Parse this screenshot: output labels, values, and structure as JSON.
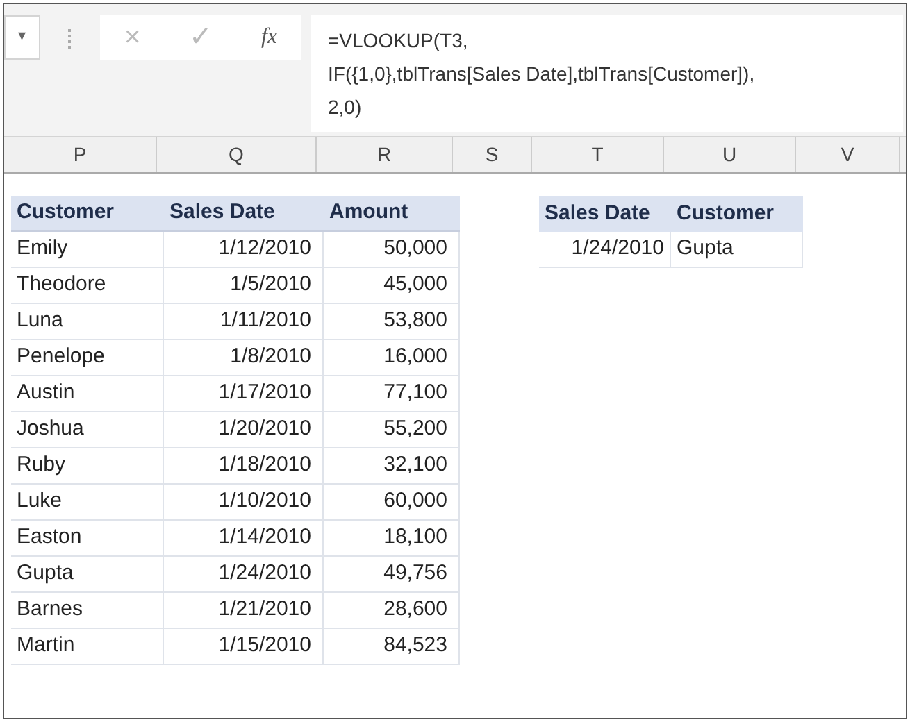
{
  "formula_bar": {
    "name_box_caret": "▾",
    "cancel": "×",
    "enter": "✓",
    "fx": "fx",
    "formula_lines": [
      "=VLOOKUP(T3,",
      "IF({1,0},tblTrans[Sales Date],tblTrans[Customer]),",
      "2,0)"
    ]
  },
  "column_headers": [
    "P",
    "Q",
    "R",
    "S",
    "T",
    "U",
    "V"
  ],
  "sales_table": {
    "columns": [
      "Customer",
      "Sales Date",
      "Amount"
    ],
    "rows": [
      [
        "Emily",
        "1/12/2010",
        "50,000"
      ],
      [
        "Theodore",
        "1/5/2010",
        "45,000"
      ],
      [
        "Luna",
        "1/11/2010",
        "53,800"
      ],
      [
        "Penelope",
        "1/8/2010",
        "16,000"
      ],
      [
        "Austin",
        "1/17/2010",
        "77,100"
      ],
      [
        "Joshua",
        "1/20/2010",
        "55,200"
      ],
      [
        "Ruby",
        "1/18/2010",
        "32,100"
      ],
      [
        "Luke",
        "1/10/2010",
        "60,000"
      ],
      [
        "Easton",
        "1/14/2010",
        "18,100"
      ],
      [
        "Gupta",
        "1/24/2010",
        "49,756"
      ],
      [
        "Barnes",
        "1/21/2010",
        "28,600"
      ],
      [
        "Martin",
        "1/15/2010",
        "84,523"
      ]
    ]
  },
  "lookup_table": {
    "columns": [
      "Sales Date",
      "Customer"
    ],
    "rows": [
      [
        "1/24/2010",
        "Gupta"
      ]
    ]
  }
}
